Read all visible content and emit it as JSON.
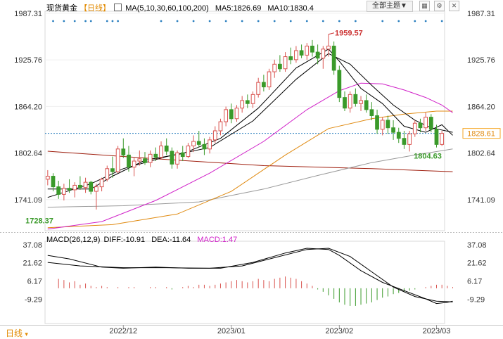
{
  "header": {
    "symbol": "现货黄金",
    "period": "【日线】",
    "ma_label": "MA(5,10,30,60,100,200)",
    "ma5": "MA5:1826.69",
    "ma10": "MA10:1830.4",
    "theme_button": "全部主题▼",
    "icons": [
      "grid-icon",
      "gear-icon",
      "close-icon"
    ]
  },
  "macd_header": {
    "label": "MACD(26,12,9)",
    "diff": "DIFF:-10.91",
    "dea": "DEA:-11.64",
    "macd": "MACD:1.47"
  },
  "footer": {
    "period_tab": "日线"
  },
  "colors": {
    "up": "#d9534f",
    "down": "#3a9a2a",
    "ma5": "#000000",
    "ma10": "#000000",
    "ma30": "#d020c8",
    "ma60": "#e08a10",
    "ma100": "#999999",
    "ma200": "#a02010",
    "last_price_bg": "#f5a623",
    "diff": "#000000",
    "dea": "#000000",
    "macd_label": "#d020c8"
  },
  "chart_data": [
    {
      "type": "candlestick",
      "ylim": [
        1700,
        1990
      ],
      "y_ticks_left": [
        "1987.31",
        "1925.76",
        "1864.20",
        "1802.64",
        "1741.09"
      ],
      "y_ticks_right": [
        "1987.31",
        "1925.76",
        "1864.20",
        "1802.64",
        "1741.09"
      ],
      "x_labels": [
        "2022/12",
        "2023/01",
        "2023/02",
        "2023/03"
      ],
      "annotations": {
        "high": "1959.57",
        "low": "1728.37",
        "recent_low": "1804.63",
        "last_price": "1828.61"
      },
      "candles": [
        [
          1768,
          1780,
          1760,
          1772
        ],
        [
          1772,
          1776,
          1752,
          1758
        ],
        [
          1758,
          1766,
          1742,
          1748
        ],
        [
          1748,
          1762,
          1740,
          1756
        ],
        [
          1756,
          1768,
          1750,
          1754
        ],
        [
          1754,
          1764,
          1744,
          1760
        ],
        [
          1760,
          1772,
          1754,
          1757
        ],
        [
          1757,
          1770,
          1750,
          1764
        ],
        [
          1764,
          1766,
          1748,
          1752
        ],
        [
          1752,
          1762,
          1728,
          1758
        ],
        [
          1758,
          1770,
          1752,
          1768
        ],
        [
          1768,
          1786,
          1765,
          1782
        ],
        [
          1782,
          1798,
          1770,
          1778
        ],
        [
          1778,
          1812,
          1776,
          1808
        ],
        [
          1808,
          1822,
          1796,
          1800
        ],
        [
          1800,
          1812,
          1778,
          1784
        ],
        [
          1784,
          1796,
          1772,
          1792
        ],
        [
          1792,
          1806,
          1786,
          1795
        ],
        [
          1795,
          1804,
          1787,
          1790
        ],
        [
          1790,
          1806,
          1784,
          1801
        ],
        [
          1801,
          1810,
          1792,
          1797
        ],
        [
          1797,
          1818,
          1794,
          1812
        ],
        [
          1812,
          1822,
          1800,
          1805
        ],
        [
          1805,
          1810,
          1782,
          1788
        ],
        [
          1788,
          1806,
          1782,
          1803
        ],
        [
          1803,
          1812,
          1792,
          1798
        ],
        [
          1798,
          1816,
          1796,
          1812
        ],
        [
          1812,
          1826,
          1804,
          1818
        ],
        [
          1818,
          1832,
          1810,
          1814
        ],
        [
          1814,
          1822,
          1800,
          1808
        ],
        [
          1808,
          1824,
          1802,
          1820
        ],
        [
          1820,
          1838,
          1816,
          1832
        ],
        [
          1832,
          1848,
          1826,
          1844
        ],
        [
          1844,
          1864,
          1838,
          1860
        ],
        [
          1860,
          1868,
          1842,
          1848
        ],
        [
          1848,
          1866,
          1844,
          1862
        ],
        [
          1862,
          1878,
          1856,
          1872
        ],
        [
          1872,
          1880,
          1862,
          1868
        ],
        [
          1868,
          1884,
          1862,
          1880
        ],
        [
          1880,
          1902,
          1876,
          1896
        ],
        [
          1896,
          1906,
          1884,
          1890
        ],
        [
          1890,
          1914,
          1886,
          1910
        ],
        [
          1910,
          1926,
          1902,
          1920
        ],
        [
          1920,
          1932,
          1910,
          1914
        ],
        [
          1914,
          1936,
          1910,
          1930
        ],
        [
          1930,
          1942,
          1920,
          1926
        ],
        [
          1926,
          1944,
          1922,
          1938
        ],
        [
          1938,
          1946,
          1928,
          1932
        ],
        [
          1932,
          1948,
          1926,
          1944
        ],
        [
          1944,
          1952,
          1930,
          1936
        ],
        [
          1936,
          1946,
          1920,
          1928
        ],
        [
          1928,
          1944,
          1914,
          1940
        ],
        [
          1940,
          1959.57,
          1930,
          1944
        ],
        [
          1944,
          1950,
          1906,
          1912
        ],
        [
          1912,
          1918,
          1870,
          1876
        ],
        [
          1876,
          1884,
          1858,
          1862
        ],
        [
          1862,
          1884,
          1856,
          1880
        ],
        [
          1880,
          1888,
          1864,
          1868
        ],
        [
          1868,
          1878,
          1858,
          1872
        ],
        [
          1872,
          1880,
          1856,
          1860
        ],
        [
          1860,
          1870,
          1846,
          1852
        ],
        [
          1852,
          1860,
          1828,
          1834
        ],
        [
          1834,
          1850,
          1826,
          1846
        ],
        [
          1846,
          1852,
          1828,
          1836
        ],
        [
          1836,
          1846,
          1820,
          1830
        ],
        [
          1830,
          1836,
          1816,
          1822
        ],
        [
          1822,
          1832,
          1808,
          1814
        ],
        [
          1814,
          1832,
          1804.63,
          1828
        ],
        [
          1828,
          1846,
          1824,
          1842
        ],
        [
          1842,
          1848,
          1830,
          1836
        ],
        [
          1836,
          1856,
          1832,
          1850
        ],
        [
          1850,
          1854,
          1830,
          1834
        ],
        [
          1834,
          1840,
          1810,
          1814
        ],
        [
          1814,
          1832,
          1812,
          1828.61
        ]
      ],
      "ma": {
        "MA5": [
          [
            0,
            1755
          ],
          [
            8,
            1755
          ],
          [
            12,
            1772
          ],
          [
            18,
            1793
          ],
          [
            25,
            1802
          ],
          [
            32,
            1822
          ],
          [
            39,
            1862
          ],
          [
            46,
            1915
          ],
          [
            52,
            1940
          ],
          [
            54,
            1924
          ],
          [
            58,
            1888
          ],
          [
            62,
            1868
          ],
          [
            66,
            1838
          ],
          [
            70,
            1830
          ],
          [
            73,
            1840
          ],
          [
            75,
            1826
          ]
        ],
        "MA10": [
          [
            0,
            1744
          ],
          [
            8,
            1762
          ],
          [
            14,
            1782
          ],
          [
            22,
            1798
          ],
          [
            30,
            1810
          ],
          [
            38,
            1845
          ],
          [
            46,
            1900
          ],
          [
            52,
            1934
          ],
          [
            56,
            1920
          ],
          [
            60,
            1892
          ],
          [
            64,
            1866
          ],
          [
            68,
            1846
          ],
          [
            71,
            1836
          ],
          [
            75,
            1830
          ]
        ],
        "MA30": [
          [
            0,
            1702
          ],
          [
            10,
            1712
          ],
          [
            20,
            1740
          ],
          [
            30,
            1776
          ],
          [
            40,
            1818
          ],
          [
            48,
            1860
          ],
          [
            54,
            1885
          ],
          [
            58,
            1895
          ],
          [
            62,
            1894
          ],
          [
            66,
            1886
          ],
          [
            70,
            1876
          ],
          [
            73,
            1866
          ],
          [
            75,
            1856
          ]
        ],
        "MA60": [
          [
            0,
            1704
          ],
          [
            12,
            1708
          ],
          [
            24,
            1722
          ],
          [
            34,
            1752
          ],
          [
            44,
            1800
          ],
          [
            52,
            1835
          ],
          [
            60,
            1848
          ],
          [
            66,
            1854
          ],
          [
            72,
            1858
          ],
          [
            75,
            1858
          ]
        ],
        "MA100": [
          [
            0,
            1731
          ],
          [
            14,
            1733
          ],
          [
            28,
            1738
          ],
          [
            40,
            1755
          ],
          [
            50,
            1773
          ],
          [
            60,
            1790
          ],
          [
            68,
            1800
          ],
          [
            75,
            1808
          ]
        ],
        "MA200": [
          [
            0,
            1805
          ],
          [
            20,
            1795
          ],
          [
            40,
            1786
          ],
          [
            60,
            1782
          ],
          [
            75,
            1778
          ]
        ]
      }
    },
    {
      "type": "macd",
      "ylim": [
        -30,
        40
      ],
      "y_ticks": [
        "37.08",
        "21.62",
        "6.17",
        "-9.29"
      ],
      "diff": [
        [
          0,
          28
        ],
        [
          4,
          25
        ],
        [
          10,
          18
        ],
        [
          14,
          17
        ],
        [
          20,
          18
        ],
        [
          26,
          17
        ],
        [
          32,
          17
        ],
        [
          38,
          22
        ],
        [
          44,
          30
        ],
        [
          48,
          34
        ],
        [
          52,
          33
        ],
        [
          54,
          28
        ],
        [
          58,
          15
        ],
        [
          62,
          5
        ],
        [
          66,
          -2
        ],
        [
          70,
          -9
        ],
        [
          72,
          -13
        ],
        [
          74,
          -12
        ],
        [
          75,
          -11
        ]
      ],
      "dea": [
        [
          0,
          22
        ],
        [
          6,
          19
        ],
        [
          14,
          17.5
        ],
        [
          22,
          17.5
        ],
        [
          30,
          17
        ],
        [
          36,
          19
        ],
        [
          42,
          26
        ],
        [
          48,
          33
        ],
        [
          52,
          34
        ],
        [
          56,
          27
        ],
        [
          60,
          14
        ],
        [
          64,
          1
        ],
        [
          68,
          -7
        ],
        [
          72,
          -11
        ],
        [
          75,
          -11.6
        ]
      ],
      "hist": [
        0,
        0,
        8,
        7,
        5,
        6,
        3,
        4,
        2,
        1,
        2,
        1,
        0,
        1,
        0,
        1,
        1,
        0,
        0,
        1,
        1,
        0,
        1,
        -1,
        0,
        1,
        2,
        1,
        3,
        3,
        2,
        3,
        4,
        5,
        6,
        7,
        6,
        5,
        6,
        8,
        7,
        6,
        8,
        9,
        10,
        9,
        8,
        6,
        4,
        2,
        -1,
        -3,
        -6,
        -9,
        -12,
        -14,
        -15,
        -15,
        -14,
        -13,
        -12,
        -10,
        -8,
        -7,
        -5,
        -4,
        -3,
        -2,
        -1,
        0,
        1,
        2,
        3,
        3,
        2,
        1
      ]
    }
  ]
}
